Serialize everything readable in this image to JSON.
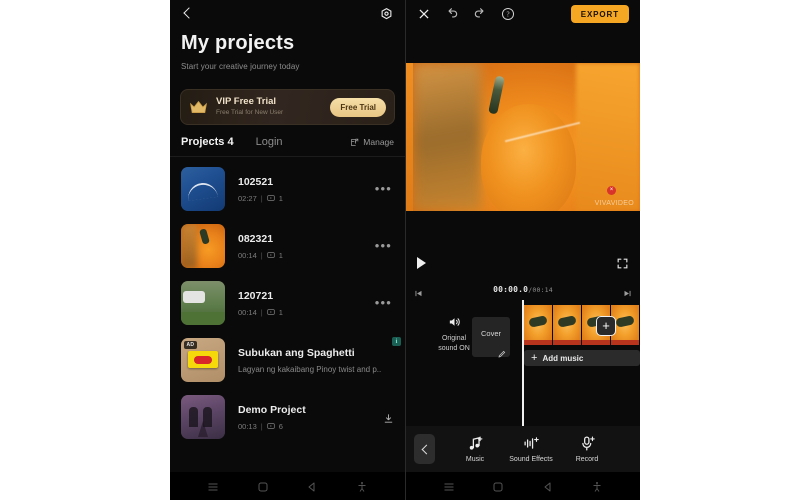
{
  "left_phone": {
    "topbar": {
      "back_icon": "chevron-left-icon",
      "settings_icon": "gear-icon"
    },
    "title": "My projects",
    "subtitle": "Start your creative journey today",
    "vip_banner": {
      "icon": "crown-icon",
      "title": "VIP Free Trial",
      "subtitle": "Free Trial for New User",
      "button_label": "Free Trial"
    },
    "tabs": {
      "projects_label": "Projects 4",
      "login_label": "Login",
      "manage_label": "Manage",
      "manage_icon": "external-link-icon"
    },
    "projects": [
      {
        "name": "102521",
        "duration": "02:27",
        "separator": "|",
        "clips": "1",
        "thumb": "blue-sky-clip",
        "more_icon": "more-options-icon"
      },
      {
        "name": "082321",
        "duration": "00:14",
        "separator": "|",
        "clips": "1",
        "thumb": "pumpkin-clip",
        "more_icon": "more-options-icon"
      },
      {
        "name": "120721",
        "duration": "00:14",
        "separator": "|",
        "clips": "1",
        "thumb": "car-park-clip",
        "more_icon": "more-options-icon"
      }
    ],
    "ad_item": {
      "badge": "AD",
      "title": "Subukan ang Spaghetti",
      "description": "Lagyan ng kakaibang Pinoy twist and p..",
      "info_badge": "i",
      "thumb": "spaghetti-product-ad"
    },
    "demo_item": {
      "name": "Demo Project",
      "duration": "00:13",
      "separator": "|",
      "clips": "6",
      "thumb": "paris-demo-clip",
      "download_icon": "download-icon"
    },
    "navbar": [
      "menu-icon",
      "home-icon",
      "back-icon",
      "accessibility-icon"
    ]
  },
  "right_phone": {
    "topbar": {
      "close_icon": "close-icon",
      "undo_icon": "undo-icon",
      "redo_icon": "redo-icon",
      "help_icon": "help-circle-icon",
      "export_label": "EXPORT"
    },
    "preview": {
      "watermark": "VIVAVIDEO",
      "watermark_close": "×",
      "content": "pumpkin-video-frame"
    },
    "player": {
      "play_icon": "play-icon",
      "fullscreen_icon": "expand-icon",
      "prev_icon": "skip-previous-icon",
      "next_icon": "skip-next-icon",
      "current_time": "00:00.0",
      "time_separator": "/",
      "total_time": "00:14"
    },
    "timeline": {
      "sound_icon": "volume-on-icon",
      "sound_label_line1": "Original",
      "sound_label_line2": "sound ON",
      "cover_label": "Cover",
      "cover_edit_icon": "edit-icon",
      "add_clip_icon": "plus-icon",
      "add_music_icon": "plus-icon",
      "add_music_label": "Add music",
      "clip_count": 4
    },
    "toolbar": {
      "back_icon": "chevron-left-icon",
      "items": [
        {
          "label": "Music",
          "icon": "music-note-add-icon"
        },
        {
          "label": "Sound Effects",
          "icon": "sound-wave-add-icon"
        },
        {
          "label": "Record",
          "icon": "microphone-add-icon"
        }
      ]
    },
    "navbar": [
      "menu-icon",
      "home-icon",
      "back-icon",
      "accessibility-icon"
    ]
  },
  "colors": {
    "accent_orange": "#f5a623",
    "vip_gold": "#e8c583",
    "background": "#0a0a0a",
    "ad_info_badge": "#1b5e54",
    "watermark_red": "#d9342b"
  }
}
